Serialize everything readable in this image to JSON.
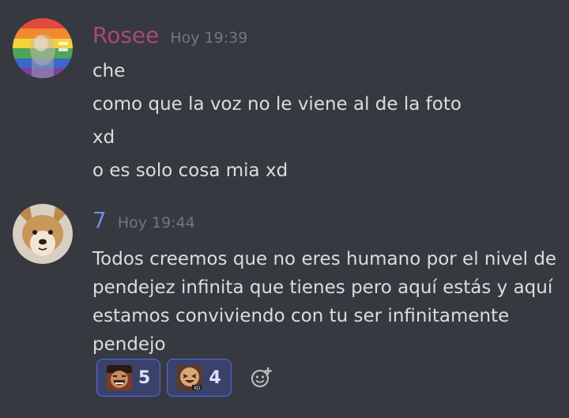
{
  "messages": [
    {
      "username": "Rosee",
      "username_color": "#a9487d",
      "timestamp": "Hoy 19:39",
      "avatar_icon": "rainbow-flag-avatar",
      "lines": [
        "che",
        "como que la voz no le viene al de la foto",
        "xd",
        "o es solo cosa mia xd"
      ]
    },
    {
      "username": "7",
      "username_color": "#7289da",
      "timestamp": "Hoy 19:44",
      "avatar_icon": "dog-avatar",
      "text": "Todos creemos que no eres humano por el nivel de pendejez infinita que tienes pero aquí estás y aquí estamos conviviendo con tu ser infinitamente pendejo",
      "reactions": [
        {
          "emoji_icon": "laughing-man-emoji",
          "count": "5"
        },
        {
          "emoji_icon": "xd-face-emoji",
          "count": "4"
        }
      ],
      "add_reaction_icon": "add-reaction-icon"
    }
  ],
  "colors": {
    "background": "#36393f",
    "text": "#dcddde",
    "timestamp": "#72767d",
    "reaction_bg": "#3b426a",
    "reaction_border": "#5865f2"
  }
}
